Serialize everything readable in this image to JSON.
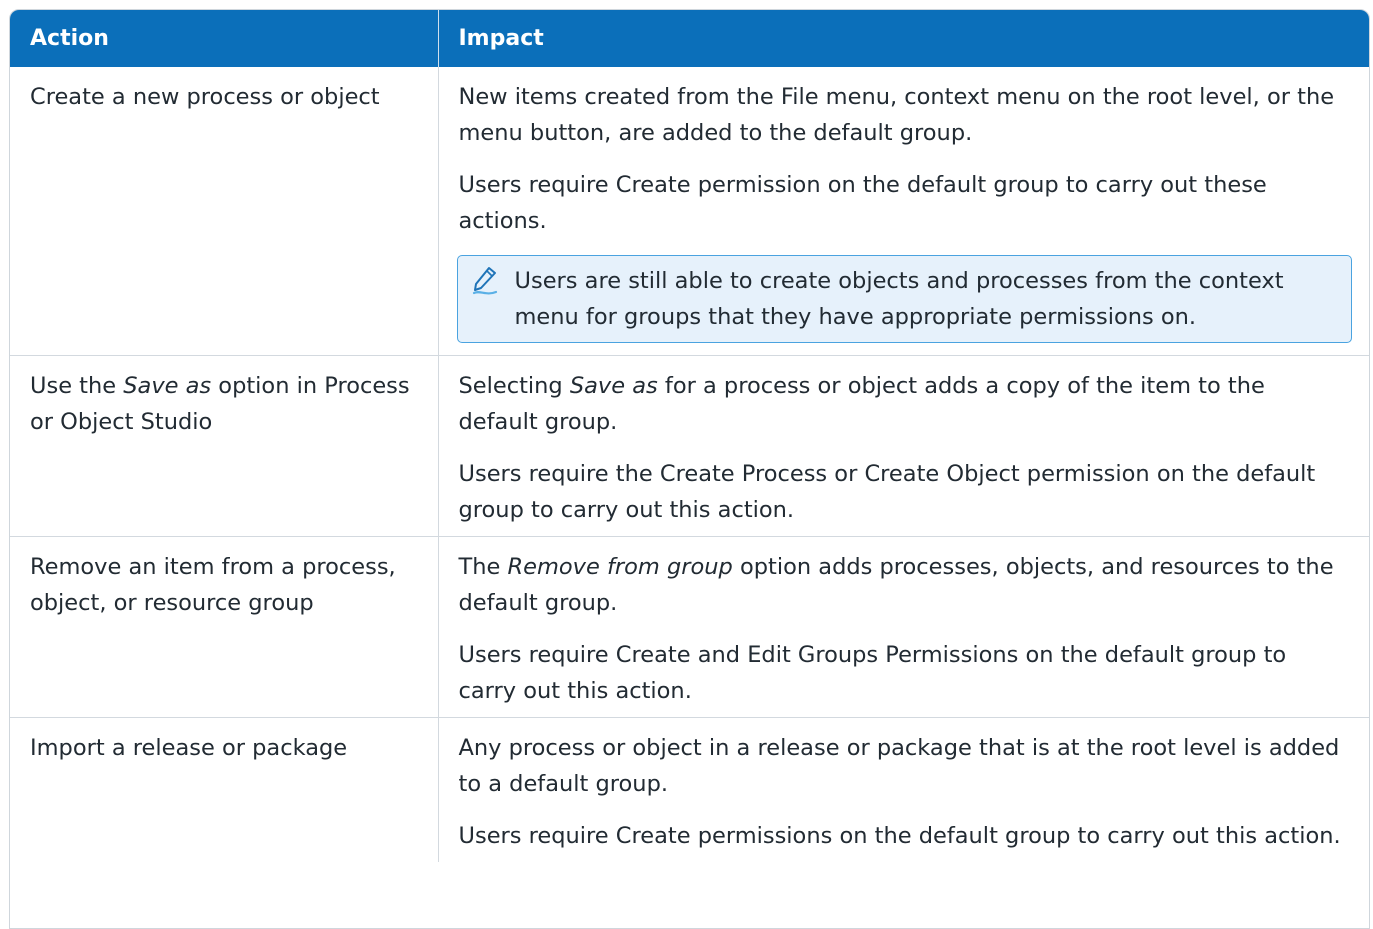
{
  "header": {
    "col_action": "Action",
    "col_impact": "Impact"
  },
  "rows": [
    {
      "action": "Create a new process or object",
      "impact_1": "New items created from the File menu, context menu on the root level, or the menu button, are added to the default group.",
      "impact_2": "Users require Create permission on the default group to carry out these actions.",
      "note_icon": "pencil-note-icon",
      "note": "Users are still able to create objects and processes from the context menu for groups that they have appropriate permissions on."
    },
    {
      "action_a": "Use the ",
      "action_em": "Save as",
      "action_b": " option in Process or Object Studio",
      "impact_1a": "Selecting ",
      "impact_1em": "Save as",
      "impact_1b": " for a process or object adds a copy of the item to the default group.",
      "impact_2": "Users require the Create Process or Create Object permission on the default group to carry out this action."
    },
    {
      "action": "Remove an item from a process, object, or resource group",
      "impact_1a": "The ",
      "impact_1em": "Remove from group",
      "impact_1b": " option adds processes, objects, and resources to the default group.",
      "impact_2": "Users require Create and Edit Groups Permissions on the default group to carry out this action."
    },
    {
      "action": "Import a release or package",
      "impact_1": "Any process or object in a release or package that is at the root level is added to a default group.",
      "impact_2": "Users require Create permissions on the default group to carry out this action."
    }
  ],
  "colors": {
    "header_bg": "#0b6fba",
    "note_bg": "#e6f1fb",
    "note_border": "#4aa3e0"
  }
}
